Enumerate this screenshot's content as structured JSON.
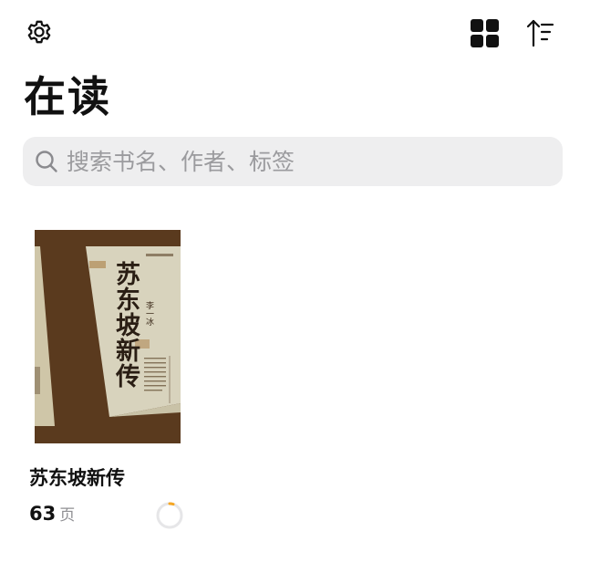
{
  "header": {
    "title": "在读"
  },
  "toolbar": {
    "settings_icon": "gear-icon",
    "view_icon": "grid-view-icon",
    "sort_icon": "sort-icon"
  },
  "search": {
    "placeholder": "搜索书名、作者、标签",
    "value": ""
  },
  "books": [
    {
      "title": "苏东坡新传",
      "cover_title": "苏东坡新传",
      "cover_author": "李一冰",
      "pages": "63",
      "pages_unit": "页",
      "progress": 0.05
    }
  ],
  "colors": {
    "accent": "#f5a623",
    "cover_dark": "#5a3a1e",
    "cover_light": "#d8d3bd"
  }
}
